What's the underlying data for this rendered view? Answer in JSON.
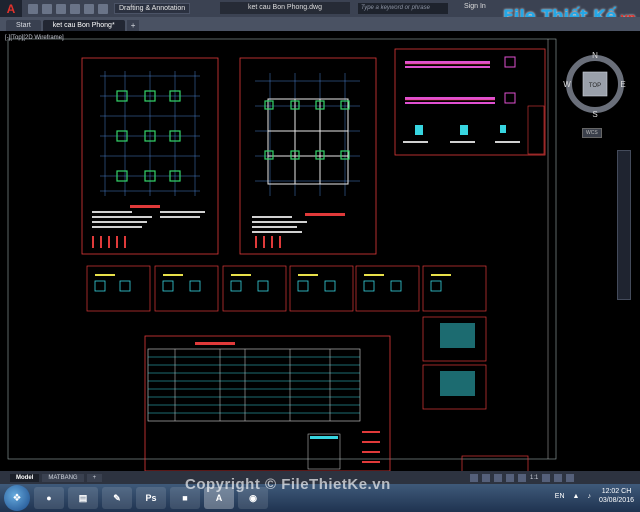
{
  "titlebar": {
    "app_logo": "A",
    "workspace": "Drafting & Annotation",
    "document_title": "ket cau Bon Phong.dwg",
    "search_placeholder": "Type a keyword or phrase",
    "signin": "Sign In",
    "brand_name": "File Thiết Kế",
    "brand_suffix": ".vn"
  },
  "tabs": [
    {
      "label": "Start"
    },
    {
      "label": "ket cau Bon Phong*"
    }
  ],
  "viewport_label": "[-][Top][2D Wireframe]",
  "compass": {
    "north": "N",
    "south": "S",
    "east": "E",
    "west": "W",
    "top": "TOP",
    "wcs": "WCS"
  },
  "layout_tabs": [
    {
      "label": "Model"
    },
    {
      "label": "MATBANG"
    }
  ],
  "status": {
    "scale": "1:1"
  },
  "watermark": "Copyright © FileThietKe.vn",
  "taskbar": {
    "apps": [
      "",
      "",
      "",
      "Ps",
      "",
      "A",
      ""
    ],
    "lang": "EN",
    "time": "12:02 CH",
    "date": "03/08/2016"
  },
  "colors": {
    "frame": "#e03a3a",
    "grid_blue": "#5aa0ff",
    "green": "#34d46b",
    "cyan": "#37d5e0",
    "magenta": "#e050d0",
    "yellow": "#e8e04a"
  }
}
